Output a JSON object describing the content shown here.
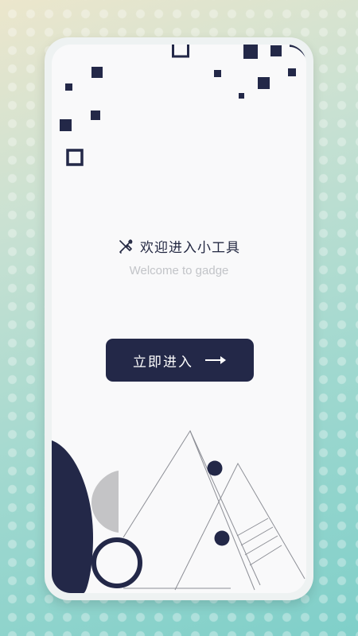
{
  "welcome": {
    "title": "欢迎进入小工具",
    "subtitle": "Welcome to gadge",
    "title_icon": "tools-icon"
  },
  "enter_button": {
    "label": "立即进入",
    "icon": "arrow-right-icon"
  },
  "colors": {
    "navy": "#232848",
    "gray_shape": "#c4c4c6",
    "subtitle": "#c2c4c8",
    "screen_bg": "#f9f9fa"
  }
}
